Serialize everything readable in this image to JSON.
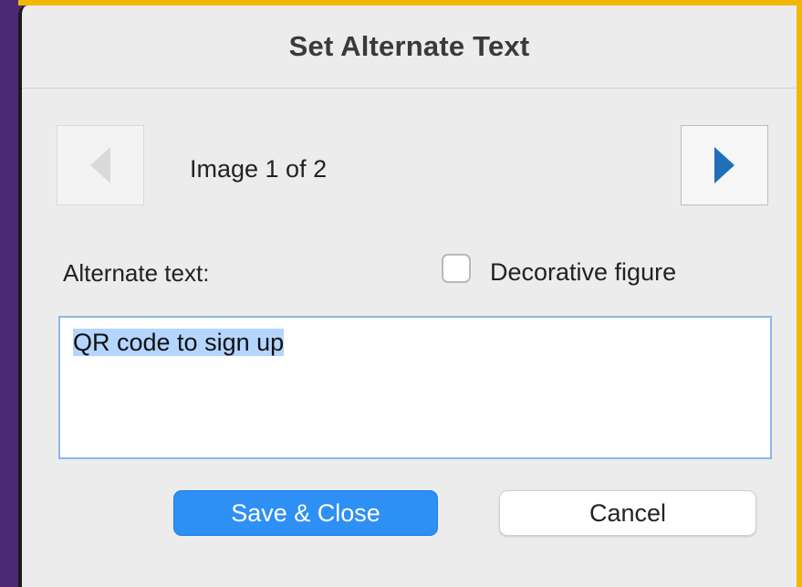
{
  "dialog": {
    "title": "Set Alternate Text",
    "image_counter": "Image 1 of 2",
    "alt_text_label": "Alternate text:",
    "decorative_label": "Decorative figure",
    "decorative_checked": false,
    "alt_text_value": "QR code to sign up",
    "save_label": "Save & Close",
    "cancel_label": "Cancel",
    "prev_icon": "triangle-left-icon",
    "next_icon": "triangle-right-icon"
  },
  "colors": {
    "frame_border": "#f2b705",
    "background": "#4a2a73",
    "accent": "#2e8ff5",
    "selection": "#b4d5fe",
    "next_arrow": "#1f6fb8"
  }
}
